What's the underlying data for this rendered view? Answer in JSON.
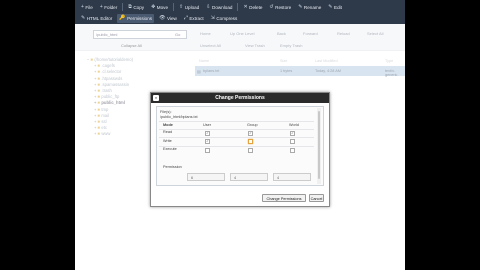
{
  "toolbar": {
    "row1": [
      {
        "icon": "+",
        "label": "File"
      },
      {
        "icon": "+",
        "label": "Folder"
      },
      {
        "icon": "⧉",
        "label": "Copy"
      },
      {
        "icon": "✥",
        "label": "Move"
      },
      {
        "icon": "⇧",
        "label": "Upload"
      },
      {
        "icon": "⇩",
        "label": "Download"
      },
      {
        "icon": "✕",
        "label": "Delete"
      },
      {
        "icon": "↺",
        "label": "Restore"
      },
      {
        "icon": "✎",
        "label": "Rename"
      },
      {
        "icon": "✎",
        "label": "Edit"
      }
    ],
    "row2": [
      {
        "icon": "✎",
        "label": "HTML Editor"
      },
      {
        "icon": "🔑",
        "label": "Permissions"
      },
      {
        "icon": "👁",
        "label": "View"
      },
      {
        "icon": "⤢",
        "label": "Extract"
      },
      {
        "icon": "⇲",
        "label": "Compress"
      }
    ]
  },
  "pathbar": {
    "path_value": "/public_html",
    "go_label": "Go",
    "collapse_label": "Collapse All"
  },
  "actions": {
    "home": "Home",
    "up_one_level": "Up One Level",
    "back": "Back",
    "forward": "Forward",
    "reload": "Reload",
    "select_all": "Select All",
    "unselect_all": "Unselect All",
    "view_trash": "View Trash",
    "empty_trash": "Empty Trash"
  },
  "tree": [
    {
      "label": "(/home/tutorialdemo)",
      "indent": 0,
      "open": true
    },
    {
      "label": ".cagefs",
      "indent": 1
    },
    {
      "label": ".cl.selector",
      "indent": 1
    },
    {
      "label": ".htpasswds",
      "indent": 1
    },
    {
      "label": ".spamassassin",
      "indent": 1
    },
    {
      "label": ".trash",
      "indent": 1
    },
    {
      "label": "public_ftp",
      "indent": 1
    },
    {
      "label": "public_html",
      "indent": 1,
      "selected": true
    },
    {
      "label": "tmp",
      "indent": 1
    },
    {
      "label": "mail",
      "indent": 1
    },
    {
      "label": "ssl",
      "indent": 1
    },
    {
      "label": "etc",
      "indent": 1
    },
    {
      "label": "www",
      "indent": 1
    }
  ],
  "file_table": {
    "headers": [
      "Name",
      "Size",
      "Last Modified",
      "Type"
    ],
    "row": {
      "name": "bplans.txt",
      "size": "1 bytes",
      "modified": "Today, 4:28 AM",
      "type": "text/x-generic"
    }
  },
  "dialog": {
    "title": "Change Permissions",
    "file_label": "File(s):",
    "file_path": "/public_html/bplans.txt",
    "mode_label": "Mode",
    "col_user": "User",
    "col_group": "Group",
    "col_world": "World",
    "rows": [
      {
        "label": "Read",
        "user": true,
        "group": true,
        "world": true
      },
      {
        "label": "Write",
        "user": true,
        "group": false,
        "world": false
      },
      {
        "label": "Execute",
        "user": false,
        "group": false,
        "world": false
      }
    ],
    "permission_label": "Permission",
    "perm_user": "6",
    "perm_group": "4",
    "perm_world": "4",
    "confirm_label": "Change Permissions",
    "cancel_label": "Cancel"
  }
}
